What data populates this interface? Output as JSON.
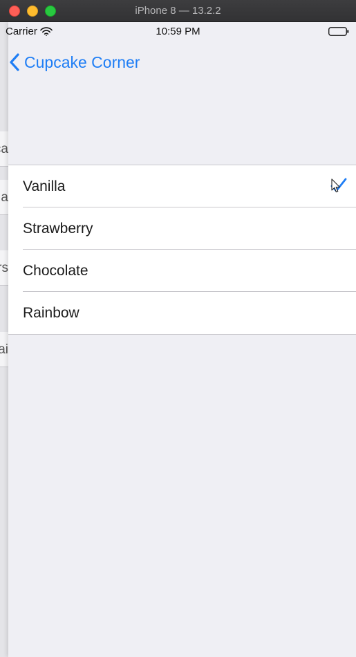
{
  "window": {
    "title": "iPhone 8 — 13.2.2"
  },
  "status_bar": {
    "carrier": "Carrier",
    "time": "10:59 PM"
  },
  "nav": {
    "back_label": "Cupcake Corner"
  },
  "previous_screen": {
    "rows": [
      "ca",
      "a",
      "rs",
      "ai"
    ]
  },
  "flavors": {
    "items": [
      {
        "label": "Vanilla",
        "selected": true
      },
      {
        "label": "Strawberry",
        "selected": false
      },
      {
        "label": "Chocolate",
        "selected": false
      },
      {
        "label": "Rainbow",
        "selected": false
      }
    ]
  },
  "colors": {
    "tint": "#1f7ef5",
    "background": "#efeff4"
  },
  "icons": {
    "wifi": "wifi-icon",
    "battery": "battery-icon",
    "back": "chevron-left-icon",
    "selected": "checkmark-icon",
    "cursor": "mouse-cursor-icon"
  }
}
